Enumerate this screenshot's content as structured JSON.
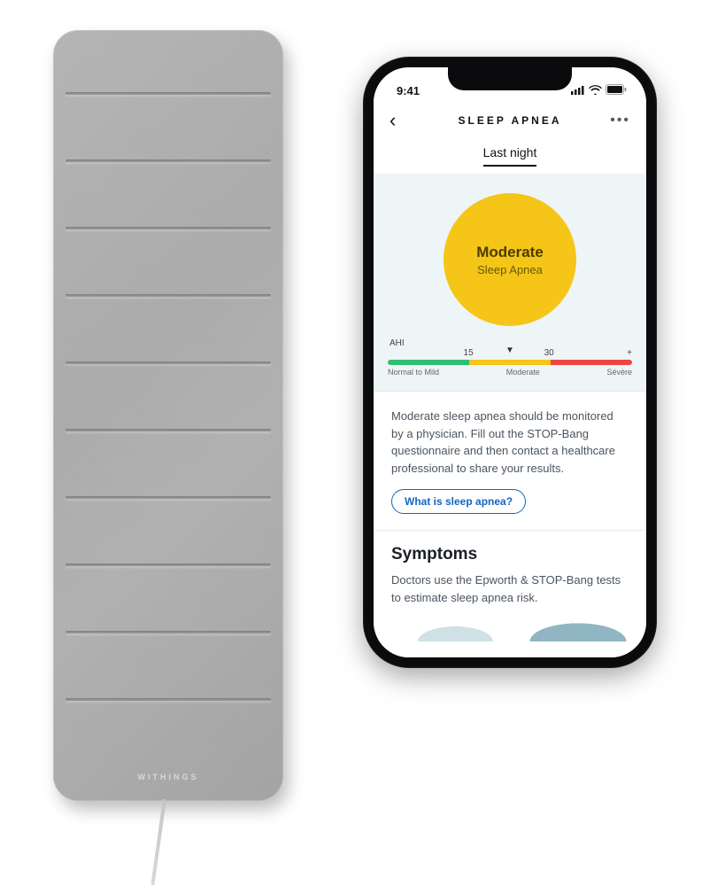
{
  "mat": {
    "brand": "WITHINGS"
  },
  "phone": {
    "status": {
      "time": "9:41"
    },
    "header": {
      "title": "SLEEP APNEA",
      "tab": "Last night"
    },
    "hero": {
      "level": "Moderate",
      "subtitle": "Sleep Apnea",
      "scale": {
        "metric": "AHI",
        "tick1": "15",
        "tick2": "30",
        "plus": "+",
        "labels": {
          "a": "Normal to Mild",
          "b": "Moderate",
          "c": "Sévère"
        }
      }
    },
    "body": {
      "desc": "Moderate sleep apnea should be monitored by a physician. Fill out the STOP-Bang questionnaire and then contact a healthcare professional to share your results.",
      "pill": "What is sleep apnea?",
      "symptoms_h": "Symptoms",
      "symptoms_desc": "Doctors use the Epworth & STOP-Bang tests to estimate sleep apnea risk."
    }
  }
}
